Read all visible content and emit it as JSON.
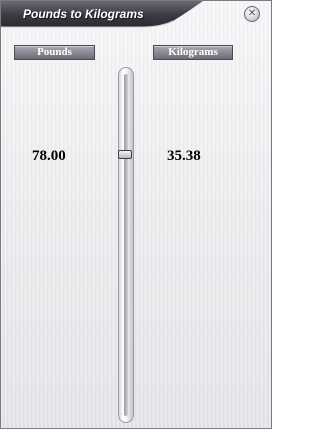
{
  "window": {
    "title": "Pounds to Kilograms",
    "close_icon": "close-icon",
    "close_glyph": "✕"
  },
  "labels": {
    "pounds": "Pounds",
    "kilograms": "Kilograms"
  },
  "values": {
    "pounds": "78.00",
    "kilograms": "35.38"
  },
  "slider": {
    "level_fraction": 0.24
  },
  "colors": {
    "title_bar": "#3d3d46",
    "button": "#8a8a94",
    "background": "#ececef"
  }
}
